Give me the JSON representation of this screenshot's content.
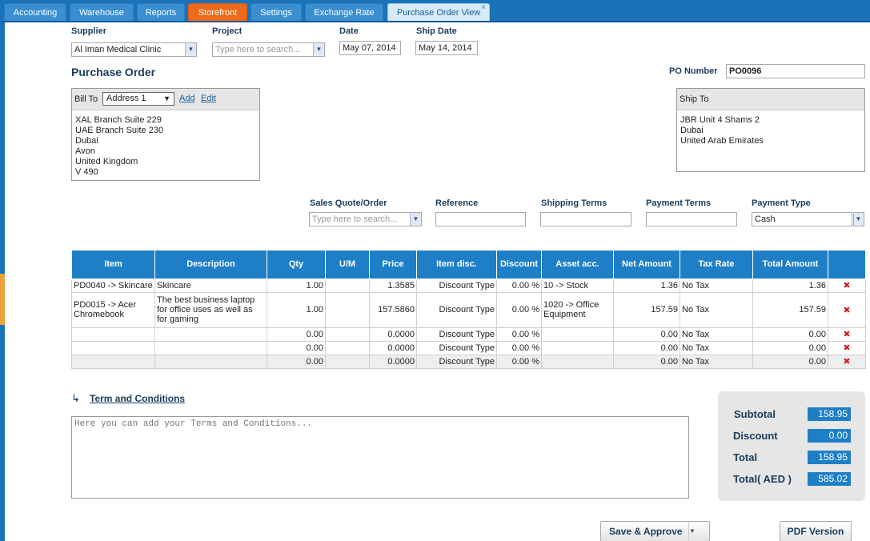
{
  "tabs": [
    {
      "label": "Accounting"
    },
    {
      "label": "Warehouse"
    },
    {
      "label": "Reports"
    },
    {
      "label": "Storefront"
    },
    {
      "label": "Settings"
    },
    {
      "label": "Exchange Rate"
    },
    {
      "label": "Purchase Order View",
      "close": "×"
    }
  ],
  "header": {
    "supplier_label": "Supplier",
    "supplier_value": "Al Iman Medical Clinic",
    "project_label": "Project",
    "project_placeholder": "Type here to search...",
    "date_label": "Date",
    "date_value": "May 07, 2014",
    "ship_date_label": "Ship Date",
    "ship_date_value": "May 14, 2014",
    "title": "Purchase Order",
    "po_number_label": "PO Number",
    "po_number_value": "PO0096"
  },
  "bill_to": {
    "label": "Bill To",
    "address_select": "Address 1",
    "add_link": "Add",
    "edit_link": "Edit",
    "lines": [
      "XAL Branch Suite 229",
      "UAE Branch Suite 230",
      "Dubai",
      "Avon",
      "United Kingdom",
      "V 490"
    ]
  },
  "ship_to": {
    "label": "Ship To",
    "lines": [
      "JBR Unit 4 Shams 2",
      "Dubai",
      "United Arab Emirates"
    ]
  },
  "meta": {
    "sales_quote_label": "Sales Quote/Order",
    "sales_quote_placeholder": "Type here to search...",
    "reference_label": "Reference",
    "shipping_terms_label": "Shipping Terms",
    "payment_terms_label": "Payment Terms",
    "payment_type_label": "Payment Type",
    "payment_type_value": "Cash"
  },
  "table": {
    "columns": [
      "Item",
      "Description",
      "Qty",
      "U/M",
      "Price",
      "Item disc.",
      "Discount",
      "Asset acc.",
      "Net Amount",
      "Tax Rate",
      "Total Amount"
    ],
    "rows": [
      {
        "item": "PD0040 -> Skincare",
        "description": "Skincare",
        "qty": "1.00",
        "um": "",
        "price": "1.3585",
        "item_disc": "Discount Type",
        "discount": "0.00 %",
        "asset": "10 -> Stock",
        "net": "1.36",
        "tax": "No Tax",
        "total": "1.36"
      },
      {
        "item": "PD0015 -> Acer Chromebook",
        "description": "The best business laptop for office uses as well as for gaming",
        "qty": "1.00",
        "um": "",
        "price": "157.5860",
        "item_disc": "Discount Type",
        "discount": "0.00 %",
        "asset": "1020 -> Office Equipment",
        "net": "157.59",
        "tax": "No Tax",
        "total": "157.59"
      },
      {
        "item": "",
        "description": "",
        "qty": "0.00",
        "um": "",
        "price": "0.0000",
        "item_disc": "Discount Type",
        "discount": "0.00 %",
        "asset": "",
        "net": "0.00",
        "tax": "No Tax",
        "total": "0.00"
      },
      {
        "item": "",
        "description": "",
        "qty": "0.00",
        "um": "",
        "price": "0.0000",
        "item_disc": "Discount Type",
        "discount": "0.00 %",
        "asset": "",
        "net": "0.00",
        "tax": "No Tax",
        "total": "0.00"
      },
      {
        "item": "",
        "description": "",
        "qty": "0.00",
        "um": "",
        "price": "0.0000",
        "item_disc": "Discount Type",
        "discount": "0.00 %",
        "asset": "",
        "net": "0.00",
        "tax": "No Tax",
        "total": "0.00"
      }
    ],
    "delete_icon": "delete-x-icon"
  },
  "terms": {
    "link": "Term and Conditions",
    "placeholder": "Here you can add your Terms and Conditions..."
  },
  "totals": {
    "subtotal_label": "Subtotal",
    "subtotal_value": "158.95",
    "discount_label": "Discount",
    "discount_value": "0.00",
    "total_label": "Total",
    "total_value": "158.95",
    "total_aed_label": "Total( AED )",
    "total_aed_value": "585.02"
  },
  "actions": {
    "save_approve": "Save & Approve",
    "pdf_version": "PDF Version"
  }
}
